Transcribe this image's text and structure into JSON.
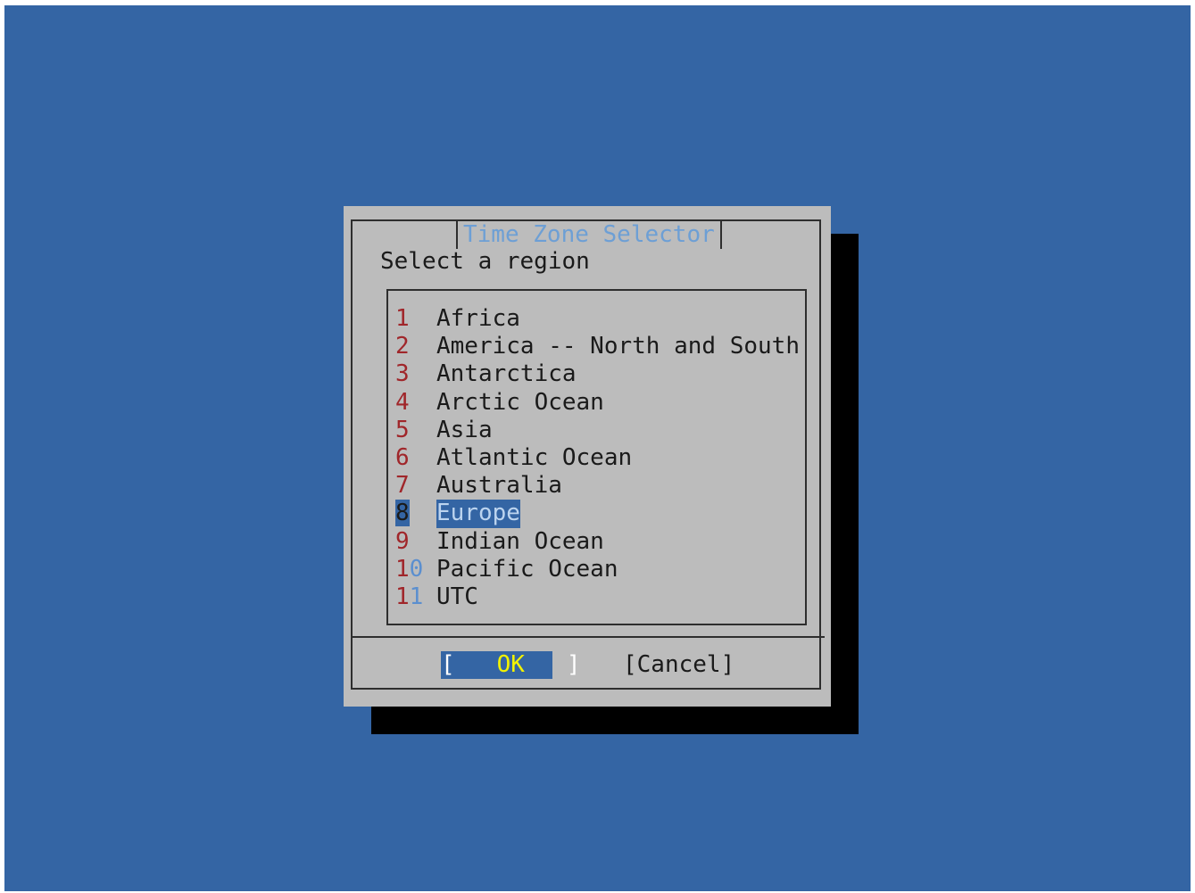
{
  "dialog": {
    "title": "Time Zone Selector",
    "prompt": "Select a region",
    "items": [
      {
        "num": "1",
        "label": "Africa"
      },
      {
        "num": "2",
        "label": "America -- North and South"
      },
      {
        "num": "3",
        "label": "Antarctica"
      },
      {
        "num": "4",
        "label": "Arctic Ocean"
      },
      {
        "num": "5",
        "label": "Asia"
      },
      {
        "num": "6",
        "label": "Atlantic Ocean"
      },
      {
        "num": "7",
        "label": "Australia"
      },
      {
        "num": "8",
        "label": "Europe"
      },
      {
        "num": "9",
        "label": "Indian Ocean"
      },
      {
        "num_1": "1",
        "num_2": "0",
        "label": "Pacific Ocean"
      },
      {
        "num_1": "1",
        "num_2": "1",
        "label": "UTC"
      }
    ],
    "selected_index": 7,
    "buttons": {
      "ok": {
        "left_bracket": "[",
        "label": "OK",
        "right_bracket": "]"
      },
      "cancel": "[Cancel]"
    }
  },
  "colors": {
    "background": "#3465a4",
    "dialog": "#bcbcbc",
    "shadow": "#000000",
    "title": "#6d9fd5",
    "hotkey": "#a0262a",
    "ok_label": "#f2f200"
  }
}
